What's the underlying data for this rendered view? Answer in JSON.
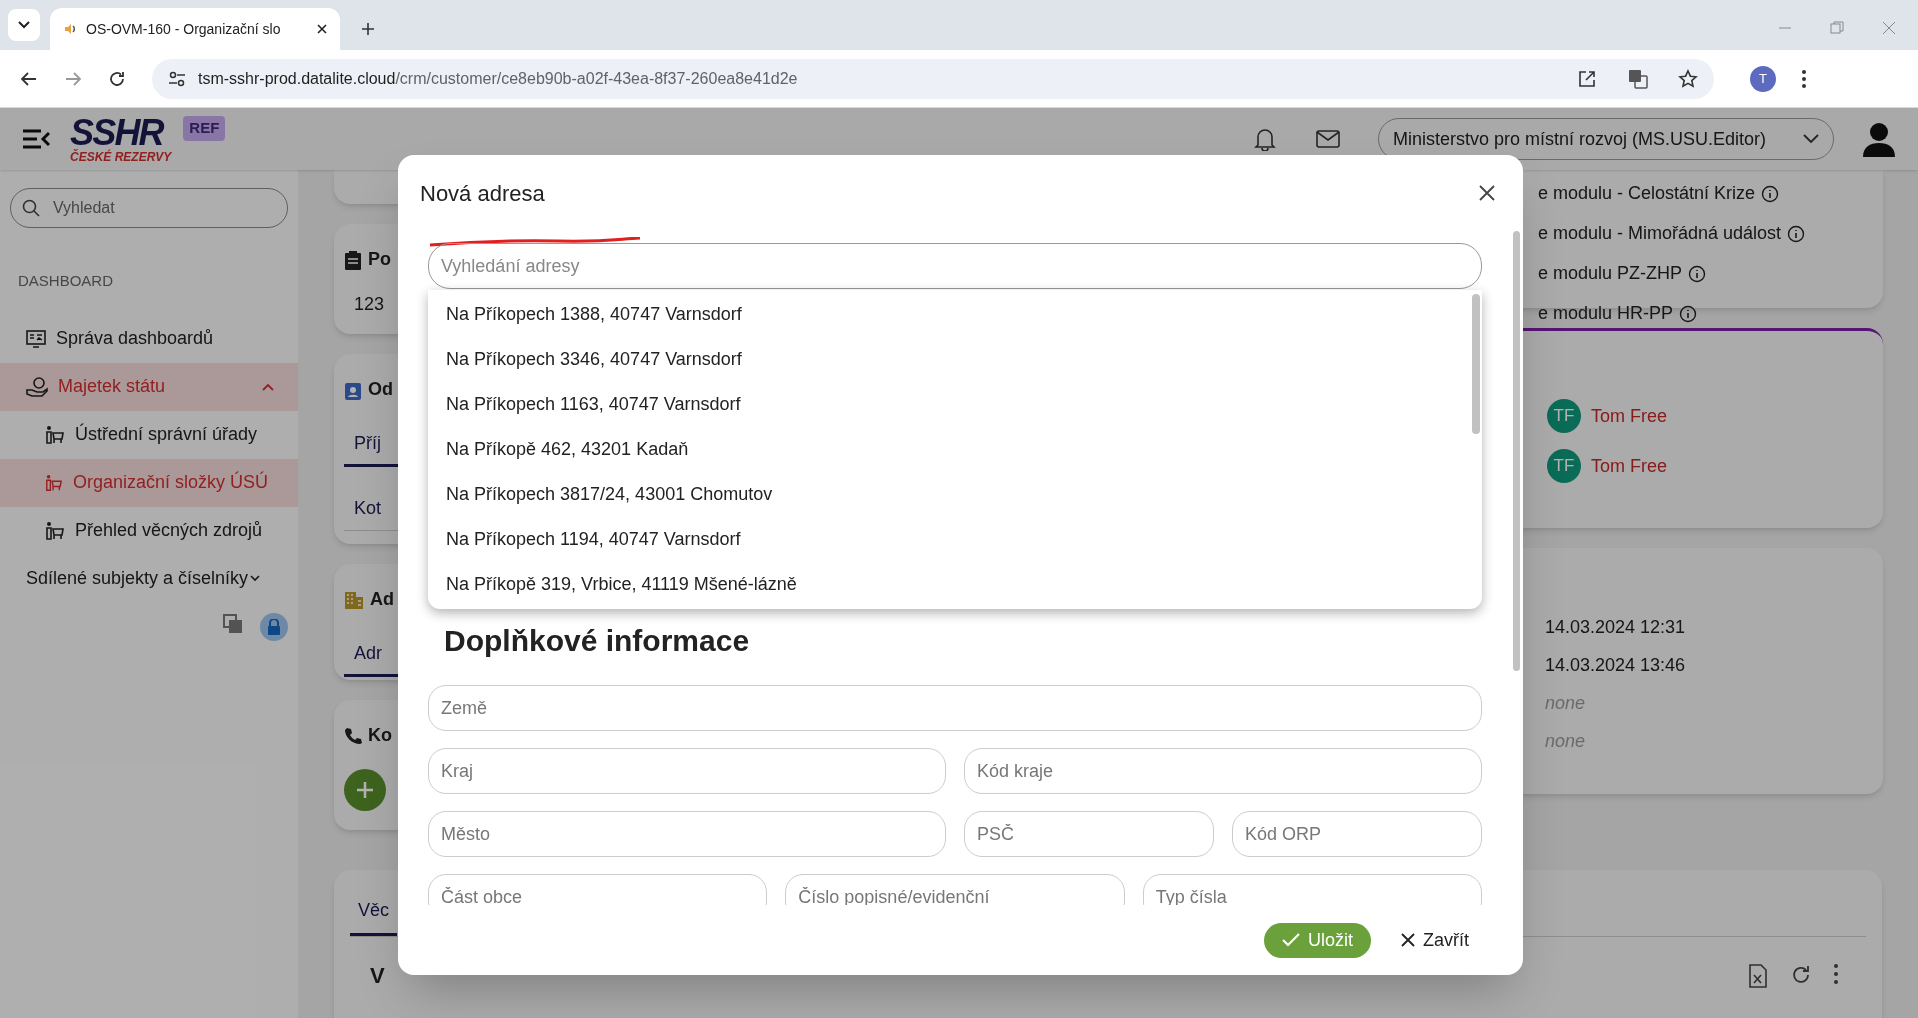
{
  "browser": {
    "tab_title": "OS-OVM-160 - Organizační slo",
    "url_host": "tsm-sshr-prod.datalite.cloud",
    "url_path": "/crm/customer/ce8eb90b-a02f-43ea-8f37-260ea8e41d2e",
    "profile_initial": "T"
  },
  "header": {
    "logo_title": "SSHR",
    "logo_subtitle": "ČESKÉ REZERVY",
    "env_badge": "REF",
    "role_select": "Ministerstvo pro místní rozvoj (MS.USU.Editor)"
  },
  "sidebar": {
    "search_placeholder": "Vyhledat",
    "section": "DASHBOARD",
    "items": [
      {
        "label": "Správa dashboardů",
        "selected": false
      },
      {
        "label": "Majetek státu",
        "selected": true,
        "expanded": true,
        "children": [
          {
            "label": "Ústřední správní úřady",
            "selected": false
          },
          {
            "label": "Organizační složky ÚSÚ",
            "selected": true
          },
          {
            "label": "Přehled věcných zdrojů",
            "selected": false
          }
        ]
      },
      {
        "label": "Sdílené subjekty a číselníky",
        "selected": false,
        "expanded": false
      }
    ]
  },
  "background": {
    "left_cards": [
      {
        "kind": "blank"
      },
      {
        "kind": "text",
        "title": "Po",
        "value": "123"
      },
      {
        "kind": "tabs",
        "title": "Od",
        "tabs": [
          {
            "label": "Příj",
            "selected": true
          },
          {
            "label": "Kot",
            "selected": false
          }
        ]
      },
      {
        "kind": "tabs",
        "title": "Ad",
        "tabs": [
          {
            "label": "Adr",
            "selected": true
          }
        ]
      },
      {
        "kind": "add",
        "title": "Ko"
      }
    ],
    "modules": [
      "e modulu - Celostátní Krize",
      "e modulu - Mimořádná událost",
      "e modulu PZ-ZHP",
      "e modulu HR-PP"
    ],
    "assignees": [
      {
        "initials": "TF",
        "name": "Tom Free"
      },
      {
        "initials": "TF",
        "name": "Tom Free"
      }
    ],
    "details": [
      {
        "text": "14.03.2024 12:31",
        "kind": "value"
      },
      {
        "text": "14.03.2024 13:46",
        "kind": "value"
      },
      {
        "text": "none",
        "kind": "empty"
      },
      {
        "text": "none",
        "kind": "empty"
      }
    ],
    "bottom": {
      "tab": {
        "label": "Věc",
        "selected": true
      },
      "heading": "V"
    }
  },
  "modal": {
    "title": "Nová adresa",
    "search_placeholder": "Vyhledání adresy",
    "suggestions": [
      "Na Příkopech 1388, 40747 Varnsdorf",
      "Na Příkopech 3346, 40747 Varnsdorf",
      "Na Příkopech 1163, 40747 Varnsdorf",
      "Na Příkopě 462, 43201 Kadaň",
      "Na Příkopech 3817/24, 43001 Chomutov",
      "Na Příkopech 1194, 40747 Varnsdorf",
      "Na Příkopě 319, Vrbice, 41119 Mšené-lázně"
    ],
    "section_title": "Doplňkové informace",
    "field_rows": [
      [
        {
          "placeholder": "Země"
        }
      ],
      [
        {
          "placeholder": "Kraj"
        },
        {
          "placeholder": "Kód kraje"
        }
      ],
      [
        {
          "placeholder": "Město"
        },
        {
          "placeholder": "PSČ"
        },
        {
          "placeholder": "Kód ORP"
        }
      ],
      [
        {
          "placeholder": "Část obce"
        },
        {
          "placeholder": "Číslo popisné/evidenční"
        },
        {
          "placeholder": "Typ čísla"
        }
      ]
    ],
    "buttons": [
      {
        "label": "Uložit",
        "kind": "primary"
      },
      {
        "label": "Zavřít",
        "kind": "secondary"
      }
    ]
  }
}
